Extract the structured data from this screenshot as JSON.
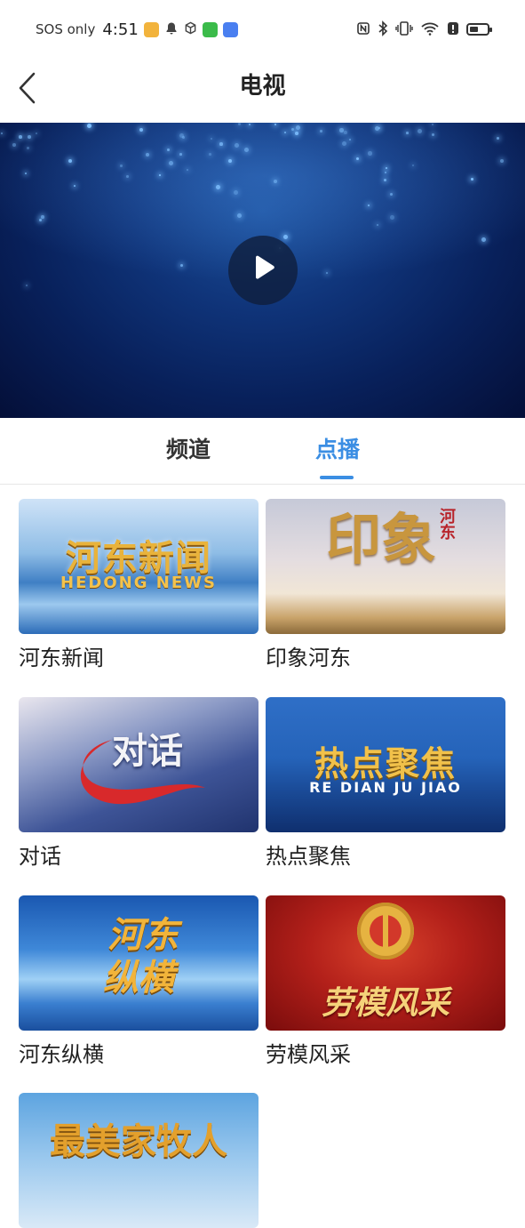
{
  "status_bar": {
    "left_text": "SOS only",
    "time": "4:51",
    "battery_level": 0.5,
    "app_icons": [
      {
        "name": "mail-app-icon",
        "color": "#f2b33c"
      },
      {
        "name": "bell-icon",
        "color": "#444444"
      },
      {
        "name": "cube-icon",
        "color": "#444444"
      },
      {
        "name": "wechat-app-icon",
        "color": "#3bbb4a"
      },
      {
        "name": "blue-app-icon",
        "color": "#4a7ff0"
      }
    ]
  },
  "header": {
    "title": "电视",
    "back_icon": "chevron-left-icon"
  },
  "player": {
    "play_icon": "play-icon"
  },
  "tabs": [
    {
      "label": "频道",
      "active": false
    },
    {
      "label": "点播",
      "active": true
    }
  ],
  "programs": [
    {
      "title": "河东新闻",
      "thumb_title": "河东新闻",
      "thumb_subtitle": "HEDONG NEWS"
    },
    {
      "title": "印象河东",
      "thumb_title": "印象",
      "thumb_subtitle": "河东"
    },
    {
      "title": "对话",
      "thumb_title": "对话",
      "thumb_subtitle": ""
    },
    {
      "title": "热点聚焦",
      "thumb_title": "热点聚焦",
      "thumb_subtitle": "RE DIAN JU JIAO"
    },
    {
      "title": "河东纵横",
      "thumb_title": "河东",
      "thumb_subtitle": "纵横"
    },
    {
      "title": "劳模风采",
      "thumb_title": "劳模风采",
      "thumb_subtitle": ""
    },
    {
      "title": "",
      "thumb_title": "最美家牧人",
      "thumb_subtitle": ""
    }
  ],
  "colors": {
    "accent": "#3b8ee3",
    "text": "#222222"
  }
}
